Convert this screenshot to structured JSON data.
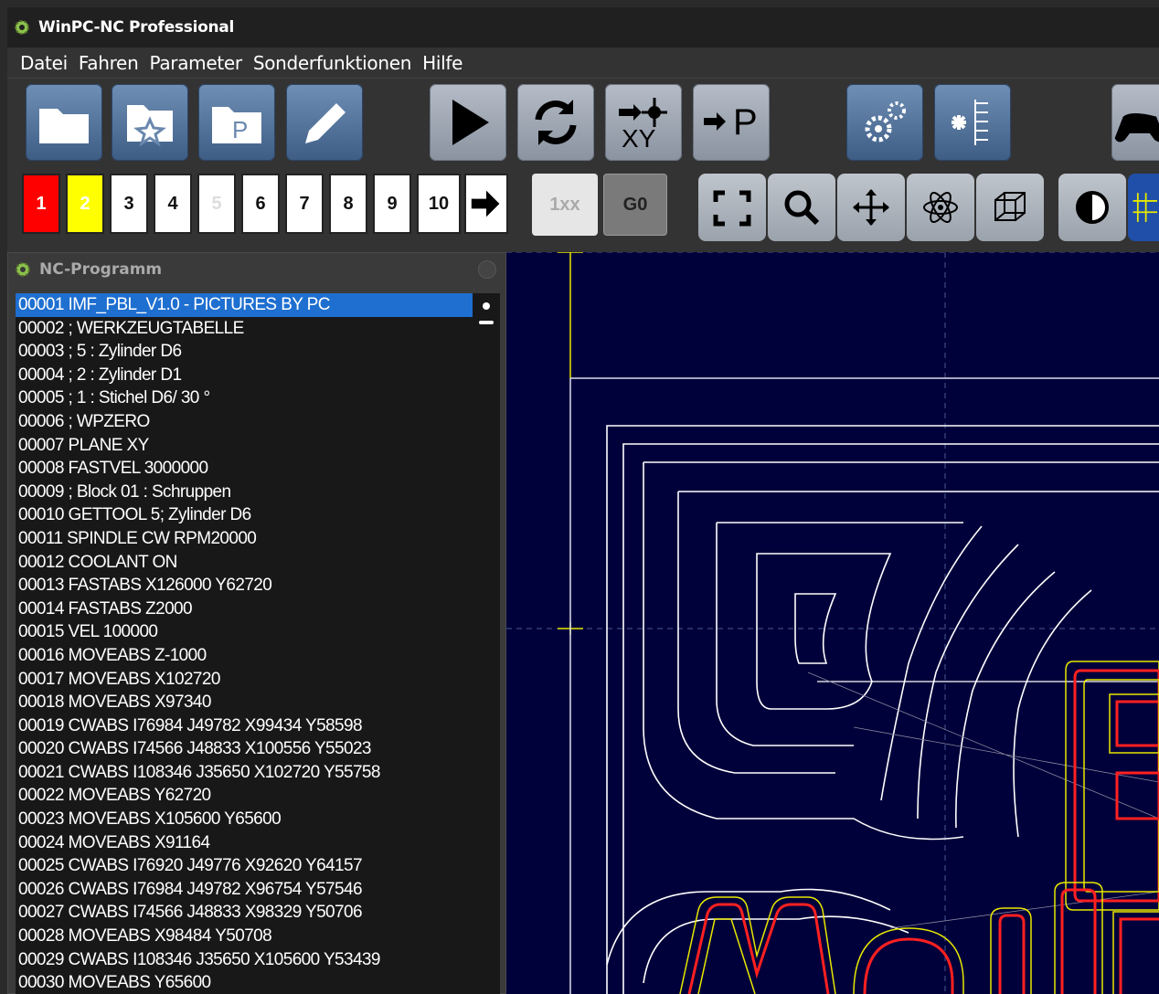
{
  "window": {
    "title": "WinPC-NC Professional"
  },
  "menu": [
    "Datei",
    "Fahren",
    "Parameter",
    "Sonderfunktionen",
    "Hilfe"
  ],
  "toolbar1": {
    "buttons": [
      "open-folder",
      "favorites-folder",
      "program-folder",
      "edit",
      "start",
      "refresh",
      "move-to-xy",
      "move-to-parking",
      "settings",
      "tool-table",
      "gamepad"
    ],
    "xy_label": "XY",
    "park_label": "P"
  },
  "toolbar2": {
    "numbers": [
      "1",
      "2",
      "3",
      "4",
      "5",
      "6",
      "7",
      "8",
      "9",
      "10"
    ],
    "speed_label": "1xx",
    "g0_label": "G0",
    "views": [
      "fullscreen",
      "zoom",
      "move",
      "3d-atom",
      "cube-view",
      "contrast",
      "grid"
    ]
  },
  "nc_panel": {
    "title": "NC-Programm",
    "selected_index": 0,
    "lines": [
      "00001  IMF_PBL_V1.0 - PICTURES BY PC",
      "00002  ; WERKZEUGTABELLE",
      "00003  ; 5 : Zylinder D6",
      "00004  ; 2 : Zylinder D1",
      "00005  ; 1 : Stichel D6/ 30 °",
      "00006  ; WPZERO",
      "00007  PLANE XY",
      "00008  FASTVEL 3000000",
      "00009  ; Block 01 : Schruppen",
      "00010  GETTOOL 5; Zylinder D6",
      "00011  SPINDLE CW RPM20000",
      "00012  COOLANT ON",
      "00013  FASTABS X126000 Y62720",
      "00014  FASTABS Z2000",
      "00015  VEL 100000",
      "00016  MOVEABS Z-1000",
      "00017  MOVEABS X102720",
      "00018  MOVEABS X97340",
      "00019  CWABS I76984 J49782 X99434 Y58598",
      "00020  CWABS I74566 J48833 X100556 Y55023",
      "00021  CWABS I108346 J35650 X102720 Y55758",
      "00022  MOVEABS Y62720",
      "00023  MOVEABS X105600 Y65600",
      "00024  MOVEABS X91164",
      "00025  CWABS I76920 J49776 X92620 Y64157",
      "00026  CWABS I76984 J49782 X96754 Y57546",
      "00027  CWABS I74566 J48833 X98329 Y50706",
      "00028  MOVEABS X98484 Y50708",
      "00029  CWABS I108346 J35650 X105600 Y53439",
      "00030  MOVEABS Y65600"
    ]
  },
  "colors": {
    "canvas_bg": "#00003a",
    "selection": "#1e6fd0",
    "contour_red": "#ff2020",
    "contour_yellow": "#e8e800"
  }
}
